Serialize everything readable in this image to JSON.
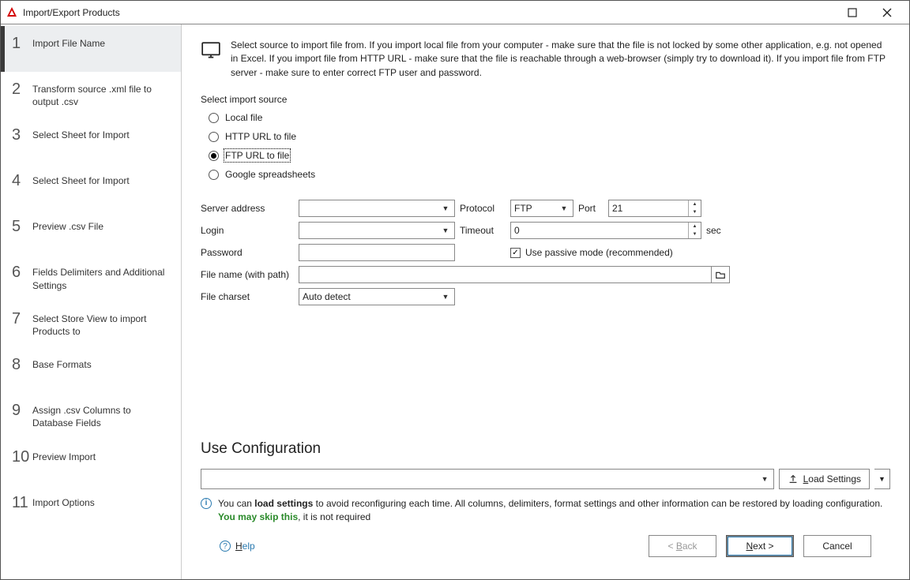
{
  "window": {
    "title": "Import/Export Products"
  },
  "sidebar": {
    "items": [
      {
        "num": "1",
        "label": "Import File Name"
      },
      {
        "num": "2",
        "label": "Transform source .xml file to output .csv"
      },
      {
        "num": "3",
        "label": "Select Sheet for Import"
      },
      {
        "num": "4",
        "label": "Select Sheet for Import"
      },
      {
        "num": "5",
        "label": "Preview .csv File"
      },
      {
        "num": "6",
        "label": "Fields Delimiters and Additional Settings"
      },
      {
        "num": "7",
        "label": "Select Store View to import Products to"
      },
      {
        "num": "8",
        "label": "Base Formats"
      },
      {
        "num": "9",
        "label": "Assign .csv Columns to Database Fields"
      },
      {
        "num": "10",
        "label": "Preview Import"
      },
      {
        "num": "11",
        "label": "Import Options"
      }
    ],
    "active_index": 0
  },
  "intro": "Select source to import file from. If you import local file from your computer - make sure that the file is not locked by some other application, e.g. not opened in Excel. If you import file from HTTP URL - make sure that the file is reachable through a web-browser (simply try to download it). If you import file from FTP server - make sure to enter correct FTP user and password.",
  "source": {
    "group_label": "Select import source",
    "options": [
      "Local file",
      "HTTP URL to file",
      "FTP URL to file",
      "Google spreadsheets"
    ],
    "selected": 2
  },
  "form": {
    "server_address_label": "Server address",
    "server_address_value": "",
    "protocol_label": "Protocol",
    "protocol_value": "FTP",
    "port_label": "Port",
    "port_value": "21",
    "login_label": "Login",
    "login_value": "",
    "timeout_label": "Timeout",
    "timeout_value": "0",
    "timeout_unit": "sec",
    "password_label": "Password",
    "password_value": "",
    "passive_label": "Use passive mode (recommended)",
    "passive_checked": true,
    "filename_label": "File name (with path)",
    "filename_value": "",
    "charset_label": "File charset",
    "charset_value": "Auto detect"
  },
  "use_config": {
    "title": "Use Configuration",
    "combo_value": "",
    "load_btn": "Load Settings",
    "info_prefix": "You can ",
    "info_bold": "load settings",
    "info_mid": " to avoid reconfiguring each time. All columns, delimiters, format settings and other information can be restored by loading configuration. ",
    "info_green": "You may skip this",
    "info_suffix": ", it is not required"
  },
  "buttons": {
    "help": "Help",
    "back": "< Back",
    "next": "Next >",
    "cancel": "Cancel"
  }
}
